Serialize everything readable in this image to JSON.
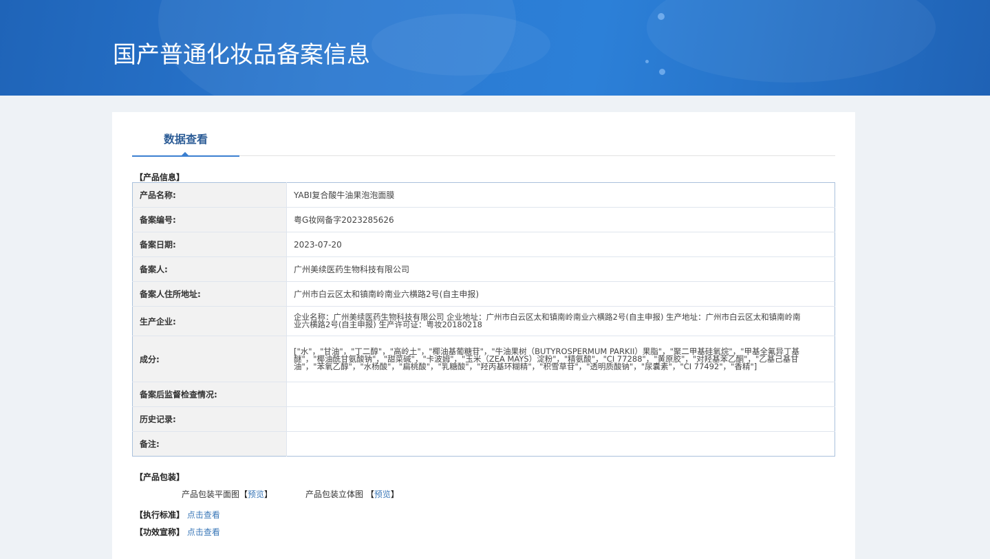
{
  "header": {
    "title": "国产普通化妆品备案信息"
  },
  "tabs": [
    {
      "label": "数据查看",
      "active": true
    }
  ],
  "product_info": {
    "section_title": "【产品信息】",
    "rows": [
      {
        "label": "产品名称:",
        "value": "YABI复合酸牛油果泡泡面膜"
      },
      {
        "label": "备案编号:",
        "value": "粤G妆网备字2023285626"
      },
      {
        "label": "备案日期:",
        "value": "2023-07-20"
      },
      {
        "label": "备案人:",
        "value": "广州美续医药生物科技有限公司"
      },
      {
        "label": "备案人住所地址:",
        "value": "广州市白云区太和镇南岭南业六横路2号(自主申报)"
      },
      {
        "label": "生产企业:",
        "value": "企业名称：广州美续医药生物科技有限公司 企业地址：广州市白云区太和镇南岭南业六横路2号(自主申报) 生产地址：广州市白云区太和镇南岭南业六横路2号(自主申报) 生产许可证：粤妆20180218"
      },
      {
        "label": "成分:",
        "value": "[\"水\"，\"甘油\"，\"丁二醇\"，\"高岭土\"，\"椰油基葡糖苷\"，\"牛油果树（BUTYROSPERMUM PARKII）果脂\"，\"聚二甲基硅氧烷\"，\"甲基全氟异丁基醚\"，\"椰油酰甘氨酸钠\"，\"甜菜碱\"，\"卡波姆\"，\"玉米（ZEA MAYS）淀粉\"，\"精氨酸\"，\"CI 77288\"，\"黄原胶\"，\"对羟基苯乙酮\"，\"乙基己基甘油\"，\"苯氧乙醇\"，\"水杨酸\"，\"扁桃酸\"，\"乳糖酸\"，\"羟丙基环糊精\"，\"积雪草苷\"，\"透明质酸钠\"，\"尿囊素\"，\"CI 77492\"，\"香精\"]"
      },
      {
        "label": "备案后监督检查情况:",
        "value": ""
      },
      {
        "label": "历史记录:",
        "value": ""
      },
      {
        "label": "备注:",
        "value": ""
      }
    ]
  },
  "packaging": {
    "section_title": "【产品包装】",
    "items": [
      {
        "label": "产品包装平面图",
        "open": "【",
        "link": "预览",
        "close": "】"
      },
      {
        "label": "产品包装立体图 ",
        "open": "【",
        "link": "预览",
        "close": "】"
      }
    ]
  },
  "standard": {
    "label": "【执行标准】",
    "link": "点击查看"
  },
  "efficacy": {
    "label": "【功效宣称】",
    "link": "点击查看"
  }
}
